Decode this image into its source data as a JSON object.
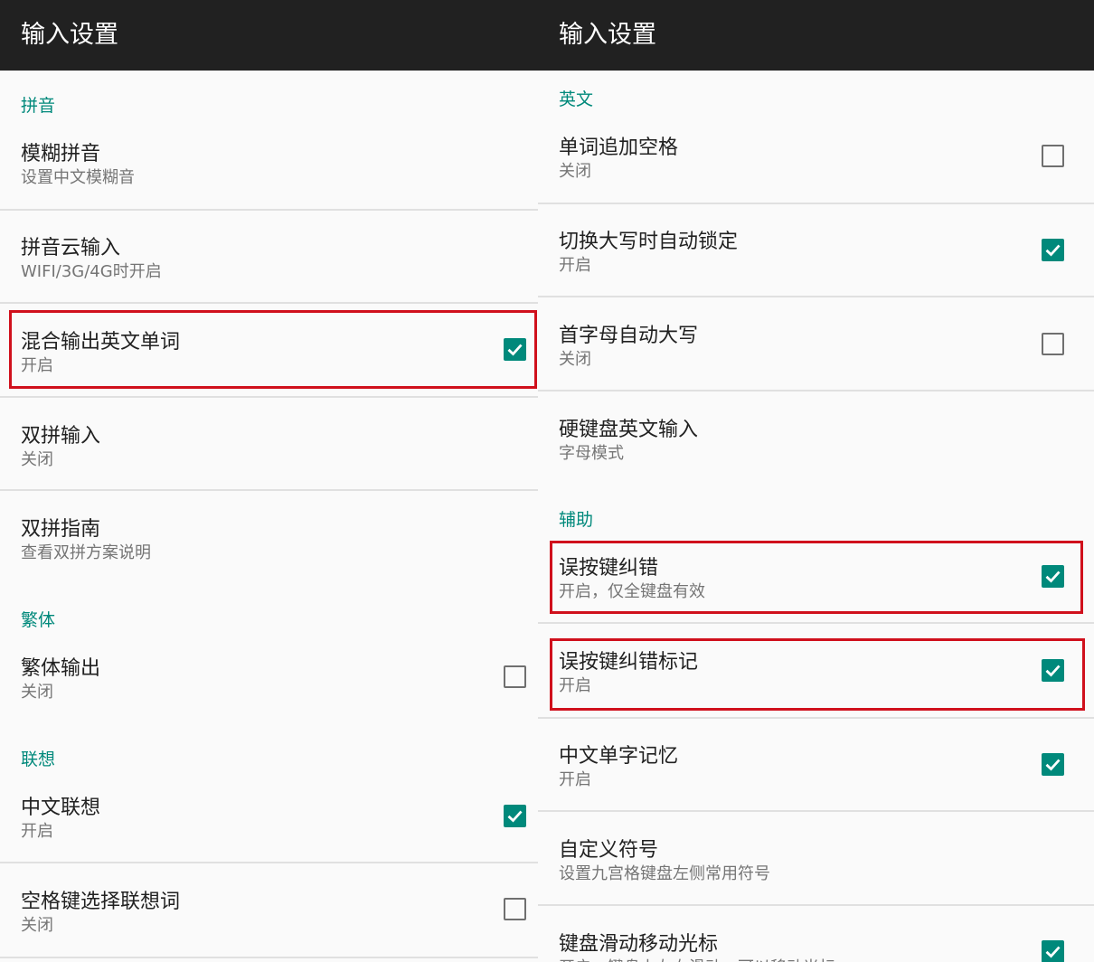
{
  "left": {
    "title": "输入设置",
    "sections": {
      "pinyin": "拼音",
      "traditional": "繁体",
      "association": "联想"
    },
    "items": {
      "fuzzy": {
        "title": "模糊拼音",
        "summary": "设置中文模糊音"
      },
      "cloud": {
        "title": "拼音云输入",
        "summary": "WIFI/3G/4G时开启"
      },
      "mixed": {
        "title": "混合输出英文单词",
        "summary": "开启",
        "checked": true
      },
      "shuangpin": {
        "title": "双拼输入",
        "summary": "关闭"
      },
      "shuangpin_guide": {
        "title": "双拼指南",
        "summary": "查看双拼方案说明"
      },
      "trad_output": {
        "title": "繁体输出",
        "summary": "关闭",
        "checked": false
      },
      "cn_assoc": {
        "title": "中文联想",
        "summary": "开启",
        "checked": true
      },
      "space_assoc": {
        "title": "空格键选择联想词",
        "summary": "关闭",
        "checked": false
      }
    }
  },
  "right": {
    "title": "输入设置",
    "sections": {
      "english": "英文",
      "assist": "辅助"
    },
    "items": {
      "add_space": {
        "title": "单词追加空格",
        "summary": "关闭",
        "checked": false
      },
      "caps_lock": {
        "title": "切换大写时自动锁定",
        "summary": "开启",
        "checked": true
      },
      "auto_cap": {
        "title": "首字母自动大写",
        "summary": "关闭",
        "checked": false
      },
      "hard_kb": {
        "title": "硬键盘英文输入",
        "summary": "字母模式"
      },
      "typo_fix": {
        "title": "误按键纠错",
        "summary": "开启，仅全键盘有效",
        "checked": true
      },
      "typo_mark": {
        "title": "误按键纠错标记",
        "summary": "开启",
        "checked": true
      },
      "char_memory": {
        "title": "中文单字记忆",
        "summary": "开启",
        "checked": true
      },
      "custom_symbol": {
        "title": "自定义符号",
        "summary": "设置九宫格键盘左侧常用符号"
      },
      "swipe_cursor": {
        "title": "键盘滑动移动光标",
        "summary": "开启，键盘上左右滑动，可以移动光标",
        "checked": true
      }
    }
  },
  "colors": {
    "accent": "#00897b",
    "titlebar": "#212121",
    "highlight": "#d0101c"
  }
}
